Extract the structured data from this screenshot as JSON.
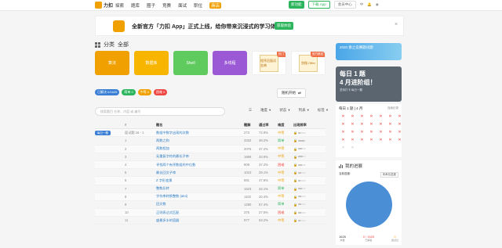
{
  "nav": {
    "logo": "力扣",
    "items": [
      "探索",
      "题库",
      "圈子",
      "竞赛",
      "面试",
      "职位",
      "商店"
    ],
    "highlight_item": "商店",
    "download_app": "新功能",
    "switch_app": "下载 App",
    "member": "会员中心",
    "lang": "中",
    "user": ""
  },
  "banner": {
    "text": "全新官方「力扣 App」正式上线，给你带来沉浸式的学习体验！",
    "button": "获取体验",
    "close": "×"
  },
  "category": {
    "label_a": "分类",
    "label_b": "全部"
  },
  "tiles": [
    {
      "label": "算法",
      "color": "#f0a000"
    },
    {
      "label": "数据库",
      "color": "#f7b500"
    },
    {
      "label": "Shell",
      "color": "#5fcb5f"
    },
    {
      "label": "多线程",
      "color": "#9b59d6"
    },
    {
      "label": "程序员面试金典",
      "tag": "热门"
    },
    {
      "label": "剑指 Offer",
      "tag": "官方精选"
    }
  ],
  "tags": [
    {
      "label": "已解决 0/1625",
      "color": "#3a7fd5"
    },
    {
      "label": "简单 0",
      "color": "#2db55d"
    },
    {
      "label": "中等 0",
      "color": "#f0a000"
    },
    {
      "label": "困难 0",
      "color": "#ef4743"
    }
  ],
  "random_button": "随机开始",
  "search": {
    "placeholder": "搜索题目 名称、内容 或 编号"
  },
  "filters": [
    "题库",
    "难度",
    "状态",
    "列表",
    "标签"
  ],
  "table": {
    "headers": [
      "",
      "#",
      "题名",
      "题解",
      "通过率",
      "难度",
      "出现频率"
    ],
    "rows": [
      {
        "daily": "每日一题",
        "idx": "面试题 16 - 1",
        "title": "数组中数字出现的次数",
        "sol": "273",
        "rate": "72.9%",
        "diff": "中等",
        "level": "mid",
        "freq": 0.3
      },
      {
        "daily": "",
        "idx": "1",
        "title": "两数之和",
        "sol": "3332",
        "rate": "48.2%",
        "diff": "简单",
        "level": "easy",
        "freq": 0.8
      },
      {
        "daily": "",
        "idx": "2",
        "title": "两数相加",
        "sol": "2075",
        "rate": "37.2%",
        "diff": "中等",
        "level": "mid",
        "freq": 0.5
      },
      {
        "daily": "",
        "idx": "3",
        "title": "无重复字符的最长子串",
        "sol": "1959",
        "rate": "33.9%",
        "diff": "中等",
        "level": "mid",
        "freq": 0.6
      },
      {
        "daily": "",
        "idx": "4",
        "title": "寻找两个有序数组的中位数",
        "sol": "909",
        "rate": "37.2%",
        "diff": "困难",
        "level": "hard",
        "freq": 0.5
      },
      {
        "daily": "",
        "idx": "5",
        "title": "最长回文子串",
        "sol": "1010",
        "rate": "29.1%",
        "diff": "中等",
        "level": "mid",
        "freq": 0.4
      },
      {
        "daily": "",
        "idx": "6",
        "title": "Z 字形变换",
        "sol": "691",
        "rate": "47.6%",
        "diff": "中等",
        "level": "mid",
        "freq": 0.3
      },
      {
        "daily": "",
        "idx": "7",
        "title": "整数反转",
        "sol": "1523",
        "rate": "34.1%",
        "diff": "简单",
        "level": "easy",
        "freq": 0.5
      },
      {
        "daily": "",
        "idx": "8",
        "title": "字符串转换整数 (atoi)",
        "sol": "1102",
        "rate": "20.4%",
        "diff": "中等",
        "level": "mid",
        "freq": 0.4
      },
      {
        "daily": "",
        "idx": "9",
        "title": "回文数",
        "sol": "1290",
        "rate": "57.4%",
        "diff": "简单",
        "level": "easy",
        "freq": 0.4
      },
      {
        "daily": "",
        "idx": "10",
        "title": "正则表达式匹配",
        "sol": "375",
        "rate": "27.5%",
        "diff": "困难",
        "level": "hard",
        "freq": 0.4
      },
      {
        "daily": "",
        "idx": "11",
        "title": "盛最多水的容器",
        "sol": "977",
        "rate": "63.2%",
        "diff": "中等",
        "level": "mid",
        "freq": 0.3
      }
    ]
  },
  "side": {
    "ad1": "2020 春之竞赛题试题",
    "ad2_title": "每日 1 题",
    "ad2_sub": "4 月进阶组！",
    "ad2_desc": "坚持打卡 每日一题",
    "calendar_title": "每日 1 题 | 4 月",
    "calendar_link": "连续纪录",
    "progress_title": "我的进展",
    "progress_label": "当前进度:",
    "progress_select": "未命名进度",
    "stats": [
      {
        "value": "1625",
        "label": "未做"
      },
      {
        "value": "0 / 1625",
        "label": "已解答"
      },
      {
        "value": "0",
        "label": "尝试过"
      }
    ]
  }
}
